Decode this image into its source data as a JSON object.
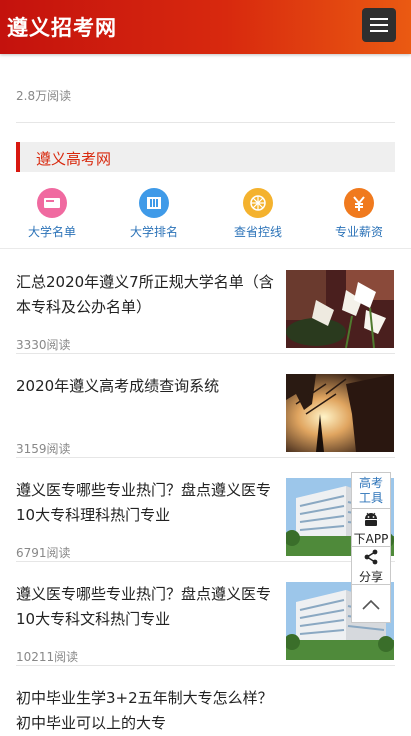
{
  "header": {
    "site_title": "遵义招考网",
    "menu_icon": "hamburger-menu-icon"
  },
  "prev_article": {
    "title_fragment": "初中毕业生学3+2五年制大专怎么样",
    "reads": "2.8万阅读"
  },
  "section": {
    "title": "遵义高考网"
  },
  "quick_nav": [
    {
      "label": "大学名单",
      "icon": "university-list-icon",
      "color": "#f06aa0"
    },
    {
      "label": "大学排名",
      "icon": "university-rank-icon",
      "color": "#3f9ae8"
    },
    {
      "label": "查省控线",
      "icon": "score-line-icon",
      "color": "#f4b22e"
    },
    {
      "label": "专业薪资",
      "icon": "salary-icon",
      "color": "#f07a1e"
    }
  ],
  "articles": [
    {
      "title": "汇总2020年遵义7所正规大学名单（含本专科及公办名单）",
      "reads": "3330阅读",
      "thumb": "lily-flowers-photo"
    },
    {
      "title": "2020年遵义高考成绩查询系统",
      "reads": "3159阅读",
      "thumb": "sunset-tree-photo"
    },
    {
      "title": "遵义医专哪些专业热门？盘点遵义医专10大专科理科热门专业",
      "reads": "6791阅读",
      "thumb": "campus-building-photo"
    },
    {
      "title": "遵义医专哪些专业热门？盘点遵义医专10大专科文科热门专业",
      "reads": "10211阅读",
      "thumb": "campus-building-photo"
    },
    {
      "title": "初中毕业生学3+2五年制大专怎么样？初中毕业可以上的大专",
      "reads": "",
      "thumb": ""
    }
  ],
  "side_tools": {
    "gaokao_line1": "高考",
    "gaokao_line2": "工具",
    "app_label": "下APP",
    "share_label": "分享",
    "back_to_top_icon": "chevron-up-icon"
  }
}
